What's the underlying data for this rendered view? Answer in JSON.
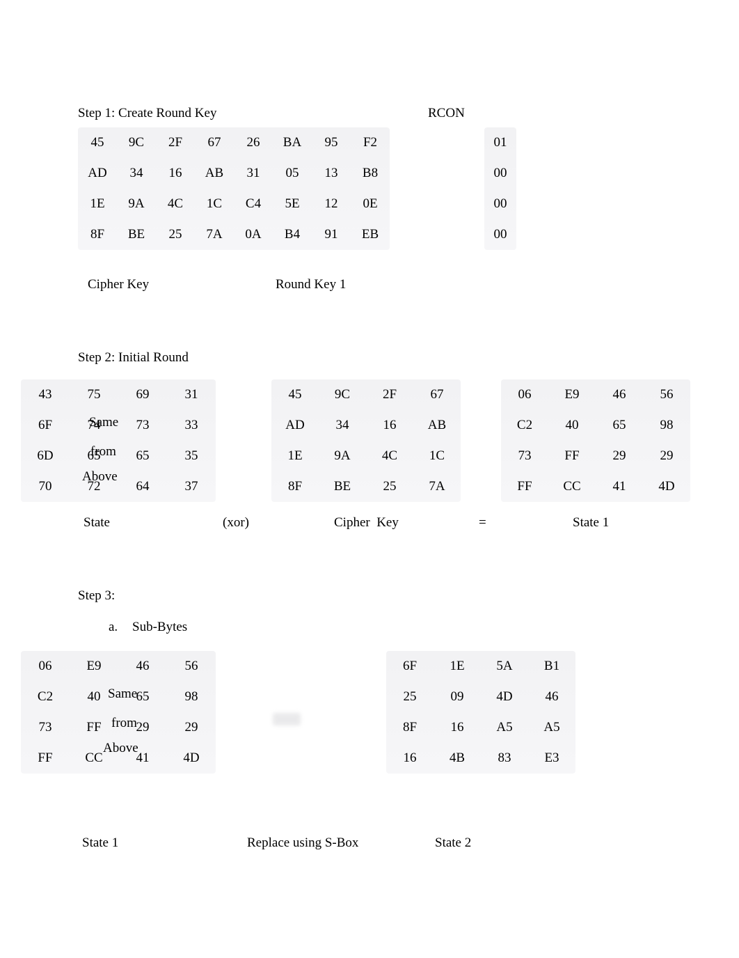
{
  "step1": {
    "title": "Step 1: Create Round Key",
    "rcon_label": "RCON",
    "rcon": [
      "01",
      "00",
      "00",
      "00"
    ],
    "matrix": [
      [
        "45",
        "9C",
        "2F",
        "67",
        "26",
        "BA",
        "95",
        "F2"
      ],
      [
        "AD",
        "34",
        "16",
        "AB",
        "31",
        "05",
        "13",
        "B8"
      ],
      [
        "1E",
        "9A",
        "4C",
        "1C",
        "C4",
        "5E",
        "12",
        "0E"
      ],
      [
        "8F",
        "BE",
        "25",
        "7A",
        "0A",
        "B4",
        "91",
        "EB"
      ]
    ],
    "cipher_key_label": "Cipher Key",
    "round_key_label": "Round Key 1"
  },
  "step2": {
    "title": "Step 2: Initial Round",
    "state": [
      [
        "43",
        "75",
        "69",
        "31"
      ],
      [
        "6F",
        "74",
        "73",
        "33"
      ],
      [
        "6D",
        "65",
        "65",
        "35"
      ],
      [
        "70",
        "72",
        "64",
        "37"
      ]
    ],
    "state_overlay": {
      "c1r1": "Same",
      "c1r2": "from",
      "c1r3": "Above"
    },
    "cipher_key": [
      [
        "45",
        "9C",
        "2F",
        "67"
      ],
      [
        "AD",
        "34",
        "16",
        "AB"
      ],
      [
        "1E",
        "9A",
        "4C",
        "1C"
      ],
      [
        "8F",
        "BE",
        "25",
        "7A"
      ]
    ],
    "state1": [
      [
        "06",
        "E9",
        "46",
        "56"
      ],
      [
        "C2",
        "40",
        "65",
        "98"
      ],
      [
        "73",
        "FF",
        "29",
        "29"
      ],
      [
        "FF",
        "CC",
        "41",
        "4D"
      ]
    ],
    "op_xor": "(xor)",
    "op_eq": "=",
    "state_label": "State",
    "cipher_key_label": "Cipher  Key",
    "state1_label": "State 1"
  },
  "step3": {
    "title": "Step 3:",
    "sub_a": "a.",
    "sub_a_label": "Sub-Bytes",
    "state1": [
      [
        "06",
        "E9",
        "46",
        "56"
      ],
      [
        "C2",
        "40",
        "65",
        "98"
      ],
      [
        "73",
        "FF",
        "29",
        "29"
      ],
      [
        "FF",
        "CC",
        "41",
        "4D"
      ]
    ],
    "state1_overlay": {
      "c2r1": "Same",
      "c2r2": "from",
      "c2r3": "Above"
    },
    "arrow_hint": "",
    "state2": [
      [
        "6F",
        "1E",
        "5A",
        "B1"
      ],
      [
        "25",
        "09",
        "4D",
        "46"
      ],
      [
        "8F",
        "16",
        "A5",
        "A5"
      ],
      [
        "16",
        "4B",
        "83",
        "E3"
      ]
    ],
    "state1_label": "State 1",
    "replace_label": "Replace using S-Box",
    "state2_label": "State 2"
  }
}
